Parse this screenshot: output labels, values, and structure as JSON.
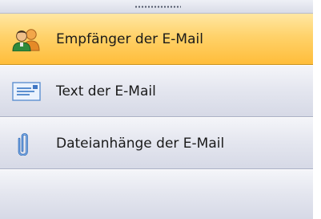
{
  "panel": {
    "items": [
      {
        "label": "Empfänger der E-Mail",
        "icon": "recipients-icon",
        "active": true
      },
      {
        "label": "Text der E-Mail",
        "icon": "email-text-icon",
        "active": false
      },
      {
        "label": "Dateianhänge der E-Mail",
        "icon": "paperclip-icon",
        "active": false
      }
    ]
  },
  "colors": {
    "active_bg": "#ffd26a",
    "inactive_bg": "#e4e6ef",
    "border": "#aab0c4"
  }
}
